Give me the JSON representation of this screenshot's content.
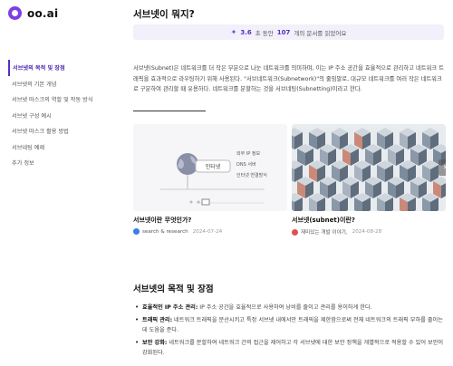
{
  "header": {
    "logo_text": "oo.ai",
    "page_title": "서브넷이 뭐지?"
  },
  "stats": {
    "seconds": "3.6",
    "seconds_unit": "초 동안",
    "docs": "107",
    "docs_unit": "개의 문서를 읽었어요"
  },
  "sidebar": {
    "items": [
      {
        "label": "서브넷의 목적 및 장점",
        "active": true
      },
      {
        "label": "서브넷의 기본 개념"
      },
      {
        "label": "서브넷 마스크의 역할 및 작동 방식"
      },
      {
        "label": "서브넷 구성 예시"
      },
      {
        "label": "서브넷 마스크 활용 방법"
      },
      {
        "label": "서브네팅 예제"
      },
      {
        "label": "추가 정보"
      }
    ]
  },
  "intro": "서브넷(Subnet)은 네트워크를 더 작은 부분으로 나눈 네트워크를 의미하며, 이는 IP 주소 공간을 효율적으로 관리하고 네트워크 트래픽을 효과적으로 라우팅하기 위해 사용된다. \"서브네트워크(Subnetwork)\"의 줄임말로, 대규모 네트워크를 여러 작은 네트워크로 구분하여 관리할 때 유용하다. 네트워크를 분할하는 것을 서브네팅(Subnetting)이라고 한다.",
  "cards": [
    {
      "title": "서브넷이란 무엇인가?",
      "source": "search & research",
      "date": "2024-07-24",
      "image_labels": {
        "center": "인터넷",
        "line1": "외부 IP 정보",
        "line2": "DNS 서버",
        "line3": "인터넷 연결방식"
      },
      "source_color": "#3b7de0"
    },
    {
      "title": "서브넷(subnet)이란?",
      "source": "재미있는 개발 이야기,",
      "date": "2024-08-28",
      "source_color": "#e05050"
    }
  ],
  "carousel": {
    "next_icon": "›"
  },
  "section": {
    "title": "서브넷의 목적 및 장점",
    "bullets": [
      {
        "term": "효율적인 IP 주소 관리:",
        "text": " IP 주소 공간을 효율적으로 사용하여 낭비를 줄이고 관리를 용이하게 한다."
      },
      {
        "term": "트래픽 관리:",
        "text": " 네트워크 트래픽을 분산시키고 특정 서브넷 내에서만 트래픽을 제한함으로써 전체 네트워크의 트래픽 부하를 줄이는 데 도움을 준다."
      },
      {
        "term": "보안 강화:",
        "text": " 네트워크를 분할하여 네트워크 간의 접근을 제어하고 각 서브넷에 대한 보안 정책을 개별적으로 적용할 수 있어 보안이 강화된다."
      }
    ]
  },
  "colors": {
    "accent": "#5b2fc0",
    "stats_bg": "#f2f0fa"
  }
}
